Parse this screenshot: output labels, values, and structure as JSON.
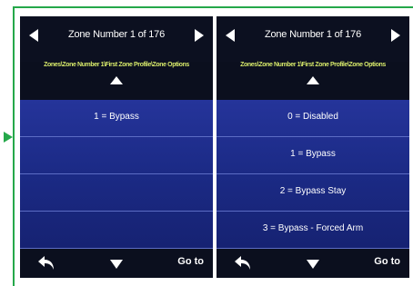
{
  "colors": {
    "frame": "#25a84a",
    "header_bg": "#0c1020",
    "list_bg": "#1b2a85",
    "breadcrumb_text": "#d6e86a",
    "divider": "#5c6cc4"
  },
  "icons": {
    "prev": "triangle-left-icon",
    "next": "triangle-right-icon",
    "scroll_up": "triangle-up-icon",
    "scroll_down": "triangle-down-icon",
    "back": "back-arrow-icon",
    "pointer": "arrow-right-icon"
  },
  "screens": [
    {
      "title": "Zone Number 1 of 176",
      "breadcrumb": "Zones\\Zone Number 1\\First Zone Profile\\Zone Options",
      "options": [
        {
          "label": "1 = Bypass"
        },
        {
          "label": ""
        },
        {
          "label": ""
        },
        {
          "label": ""
        }
      ],
      "goto_label": "Go to"
    },
    {
      "title": "Zone Number 1 of 176",
      "breadcrumb": "Zones\\Zone Number 1\\First Zone Profile\\Zone Options",
      "options": [
        {
          "label": "0 = Disabled"
        },
        {
          "label": "1 = Bypass"
        },
        {
          "label": "2 = Bypass Stay"
        },
        {
          "label": "3 = Bypass - Forced Arm"
        }
      ],
      "goto_label": "Go to"
    }
  ]
}
